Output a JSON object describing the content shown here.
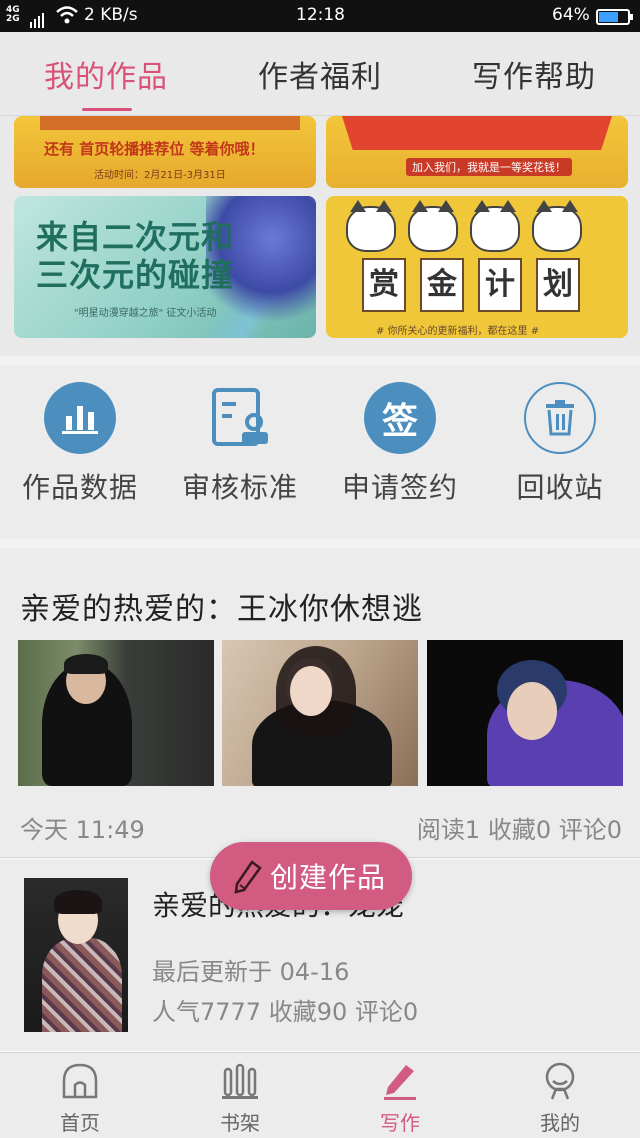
{
  "status_bar": {
    "signal_top": "4G",
    "signal_bottom": "2G",
    "network_speed": "2 KB/s",
    "time": "12:18",
    "battery": "64%",
    "battery_level": 0.64
  },
  "top_tabs": [
    {
      "label": "我的作品",
      "active": true
    },
    {
      "label": "作者福利",
      "active": false
    },
    {
      "label": "写作帮助",
      "active": false
    }
  ],
  "banners": {
    "b1_line": "还有 首页轮播推荐位 等着你哦！",
    "b1_date": "活动时间：2月21日-3月31日",
    "b2_line": "加入我们，我就是一等奖花钱！",
    "b3_title": "来自二次元和三次元的碰撞",
    "b3_sub": "\"明星动漫穿越之旅\" 征文小活动",
    "b4_signs": [
      "赏",
      "金",
      "计",
      "划"
    ],
    "b4_note": "# 你所关心的更新福利，都在这里 #"
  },
  "actions": [
    {
      "label": "作品数据",
      "icon": "bar-chart-icon"
    },
    {
      "label": "审核标准",
      "icon": "review-document-icon"
    },
    {
      "label": "申请签约",
      "icon": "sign-icon",
      "icon_text": "签"
    },
    {
      "label": "回收站",
      "icon": "trash-icon"
    }
  ],
  "featured_post": {
    "title": "亲爱的热爱的：王冰你休想逃",
    "time": "今天 11:49",
    "stats": "阅读1 收藏0 评论0"
  },
  "work_item": {
    "title": "亲爱的热爱的：宠宠",
    "updated": "最后更新于 04-16",
    "stats": "人气7777 收藏90 评论0"
  },
  "fab": {
    "label": "创建作品"
  },
  "bottom_nav": [
    {
      "label": "首页",
      "icon": "home-icon"
    },
    {
      "label": "书架",
      "icon": "bookshelf-icon"
    },
    {
      "label": "写作",
      "icon": "pen-icon",
      "active": true
    },
    {
      "label": "我的",
      "icon": "profile-icon"
    }
  ],
  "colors": {
    "accent": "#d25b82",
    "icon_blue": "#4c8fbf"
  }
}
